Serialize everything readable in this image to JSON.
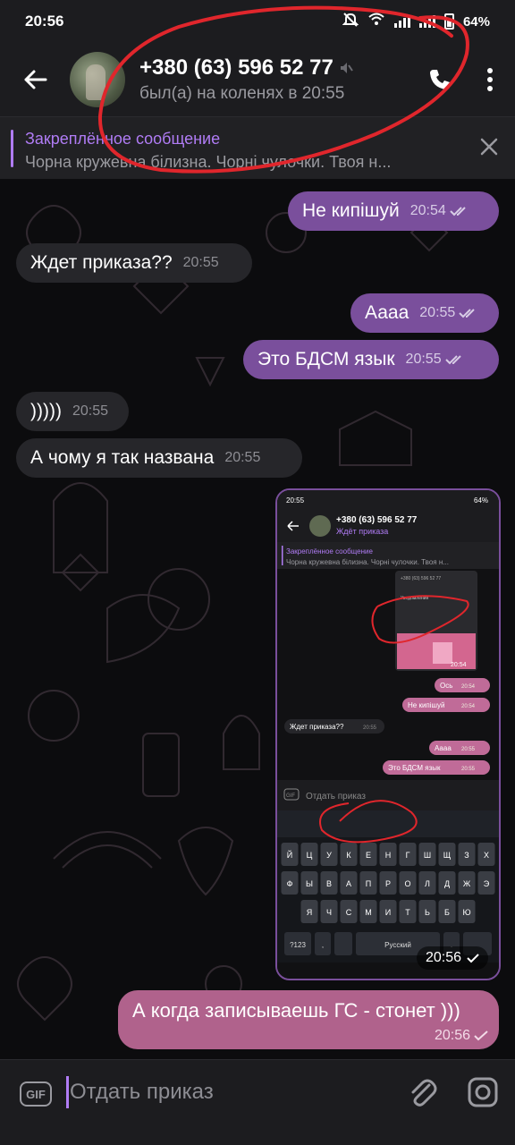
{
  "status_bar": {
    "time": "20:56",
    "battery": "64%"
  },
  "header": {
    "title": "+380 (63) 596 52 77",
    "subtitle": "был(а) на коленях в 20:55"
  },
  "pinned": {
    "title": "Закреплённое сообщение",
    "text": "Чорна кружевна білизна. Чорні чулочки.  Твоя н..."
  },
  "messages": [
    {
      "direction": "out",
      "text": "Не кипішуй",
      "time": "20:54",
      "read": true
    },
    {
      "direction": "in",
      "text": "Ждет приказа??",
      "time": "20:55"
    },
    {
      "direction": "out",
      "text": "Аааа",
      "time": "20:55",
      "read": true
    },
    {
      "direction": "out",
      "text": "Это БДСМ язык",
      "time": "20:55",
      "read": true
    },
    {
      "direction": "in",
      "text": ")))))",
      "time": "20:55"
    },
    {
      "direction": "in",
      "text": "А чому я так названа",
      "time": "20:55"
    },
    {
      "direction": "out",
      "type": "photo",
      "time": "20:56"
    },
    {
      "direction": "out",
      "text": "А когда записываешь ГС - стонет )))",
      "time": "20:56",
      "read": false
    }
  ],
  "embedded_screenshot": {
    "status_time": "20:55",
    "battery": "64%",
    "title": "+380 (63) 596 52 77",
    "subtitle": "Ждёт приказа",
    "pinned_title": "Закреплённое сообщение",
    "pinned_text": "Чорна кружевна білизна. Чорні чулочки.  Твоя н...",
    "nested_thumb": {
      "title": "+380 (63) 596 52 77",
      "setting": "Уведомления",
      "time": "20:54"
    },
    "messages": [
      {
        "direction": "out",
        "text": "Ось",
        "time": "20:54"
      },
      {
        "direction": "out",
        "text": "Не кипішуй",
        "time": "20:54"
      },
      {
        "direction": "in",
        "text": "Ждет приказа??",
        "time": "20:55"
      },
      {
        "direction": "out",
        "text": "Аааа",
        "time": "20:55"
      },
      {
        "direction": "out",
        "text": "Это БДСМ язык",
        "time": "20:55"
      }
    ],
    "input_placeholder": "Отдать приказ",
    "gif_label": "GIF",
    "keyboard_rows": [
      [
        "Й",
        "Ц",
        "У",
        "К",
        "Е",
        "Н",
        "Г",
        "Ш",
        "Щ",
        "З",
        "Х"
      ],
      [
        "Ф",
        "Ы",
        "В",
        "А",
        "П",
        "Р",
        "О",
        "Л",
        "Д",
        "Ж",
        "Э"
      ],
      [
        "Я",
        "Ч",
        "С",
        "М",
        "И",
        "Т",
        "Ь",
        "Б",
        "Ю"
      ]
    ],
    "key_numbers": "?123",
    "key_comma": ",",
    "key_space": "Русский",
    "key_period": "."
  },
  "composer": {
    "gif_label": "GIF",
    "placeholder": "Отдать приказ"
  },
  "colors": {
    "accent": "#b07cf5",
    "outgoing": "#7a4f9c",
    "incoming": "#26262a",
    "highlight_bubble": "#b0628c",
    "annotation": "#e0262c"
  }
}
